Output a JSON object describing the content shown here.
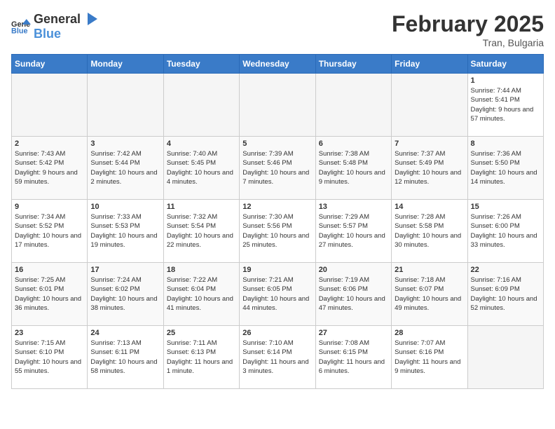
{
  "header": {
    "logo_general": "General",
    "logo_blue": "Blue",
    "title": "February 2025",
    "subtitle": "Tran, Bulgaria"
  },
  "columns": [
    "Sunday",
    "Monday",
    "Tuesday",
    "Wednesday",
    "Thursday",
    "Friday",
    "Saturday"
  ],
  "weeks": [
    {
      "days": [
        {
          "number": "",
          "info": "",
          "empty": true
        },
        {
          "number": "",
          "info": "",
          "empty": true
        },
        {
          "number": "",
          "info": "",
          "empty": true
        },
        {
          "number": "",
          "info": "",
          "empty": true
        },
        {
          "number": "",
          "info": "",
          "empty": true
        },
        {
          "number": "",
          "info": "",
          "empty": true
        },
        {
          "number": "1",
          "info": "Sunrise: 7:44 AM\nSunset: 5:41 PM\nDaylight: 9 hours and 57 minutes.",
          "empty": false
        }
      ]
    },
    {
      "days": [
        {
          "number": "2",
          "info": "Sunrise: 7:43 AM\nSunset: 5:42 PM\nDaylight: 9 hours and 59 minutes.",
          "empty": false
        },
        {
          "number": "3",
          "info": "Sunrise: 7:42 AM\nSunset: 5:44 PM\nDaylight: 10 hours and 2 minutes.",
          "empty": false
        },
        {
          "number": "4",
          "info": "Sunrise: 7:40 AM\nSunset: 5:45 PM\nDaylight: 10 hours and 4 minutes.",
          "empty": false
        },
        {
          "number": "5",
          "info": "Sunrise: 7:39 AM\nSunset: 5:46 PM\nDaylight: 10 hours and 7 minutes.",
          "empty": false
        },
        {
          "number": "6",
          "info": "Sunrise: 7:38 AM\nSunset: 5:48 PM\nDaylight: 10 hours and 9 minutes.",
          "empty": false
        },
        {
          "number": "7",
          "info": "Sunrise: 7:37 AM\nSunset: 5:49 PM\nDaylight: 10 hours and 12 minutes.",
          "empty": false
        },
        {
          "number": "8",
          "info": "Sunrise: 7:36 AM\nSunset: 5:50 PM\nDaylight: 10 hours and 14 minutes.",
          "empty": false
        }
      ]
    },
    {
      "days": [
        {
          "number": "9",
          "info": "Sunrise: 7:34 AM\nSunset: 5:52 PM\nDaylight: 10 hours and 17 minutes.",
          "empty": false
        },
        {
          "number": "10",
          "info": "Sunrise: 7:33 AM\nSunset: 5:53 PM\nDaylight: 10 hours and 19 minutes.",
          "empty": false
        },
        {
          "number": "11",
          "info": "Sunrise: 7:32 AM\nSunset: 5:54 PM\nDaylight: 10 hours and 22 minutes.",
          "empty": false
        },
        {
          "number": "12",
          "info": "Sunrise: 7:30 AM\nSunset: 5:56 PM\nDaylight: 10 hours and 25 minutes.",
          "empty": false
        },
        {
          "number": "13",
          "info": "Sunrise: 7:29 AM\nSunset: 5:57 PM\nDaylight: 10 hours and 27 minutes.",
          "empty": false
        },
        {
          "number": "14",
          "info": "Sunrise: 7:28 AM\nSunset: 5:58 PM\nDaylight: 10 hours and 30 minutes.",
          "empty": false
        },
        {
          "number": "15",
          "info": "Sunrise: 7:26 AM\nSunset: 6:00 PM\nDaylight: 10 hours and 33 minutes.",
          "empty": false
        }
      ]
    },
    {
      "days": [
        {
          "number": "16",
          "info": "Sunrise: 7:25 AM\nSunset: 6:01 PM\nDaylight: 10 hours and 36 minutes.",
          "empty": false
        },
        {
          "number": "17",
          "info": "Sunrise: 7:24 AM\nSunset: 6:02 PM\nDaylight: 10 hours and 38 minutes.",
          "empty": false
        },
        {
          "number": "18",
          "info": "Sunrise: 7:22 AM\nSunset: 6:04 PM\nDaylight: 10 hours and 41 minutes.",
          "empty": false
        },
        {
          "number": "19",
          "info": "Sunrise: 7:21 AM\nSunset: 6:05 PM\nDaylight: 10 hours and 44 minutes.",
          "empty": false
        },
        {
          "number": "20",
          "info": "Sunrise: 7:19 AM\nSunset: 6:06 PM\nDaylight: 10 hours and 47 minutes.",
          "empty": false
        },
        {
          "number": "21",
          "info": "Sunrise: 7:18 AM\nSunset: 6:07 PM\nDaylight: 10 hours and 49 minutes.",
          "empty": false
        },
        {
          "number": "22",
          "info": "Sunrise: 7:16 AM\nSunset: 6:09 PM\nDaylight: 10 hours and 52 minutes.",
          "empty": false
        }
      ]
    },
    {
      "days": [
        {
          "number": "23",
          "info": "Sunrise: 7:15 AM\nSunset: 6:10 PM\nDaylight: 10 hours and 55 minutes.",
          "empty": false
        },
        {
          "number": "24",
          "info": "Sunrise: 7:13 AM\nSunset: 6:11 PM\nDaylight: 10 hours and 58 minutes.",
          "empty": false
        },
        {
          "number": "25",
          "info": "Sunrise: 7:11 AM\nSunset: 6:13 PM\nDaylight: 11 hours and 1 minute.",
          "empty": false
        },
        {
          "number": "26",
          "info": "Sunrise: 7:10 AM\nSunset: 6:14 PM\nDaylight: 11 hours and 3 minutes.",
          "empty": false
        },
        {
          "number": "27",
          "info": "Sunrise: 7:08 AM\nSunset: 6:15 PM\nDaylight: 11 hours and 6 minutes.",
          "empty": false
        },
        {
          "number": "28",
          "info": "Sunrise: 7:07 AM\nSunset: 6:16 PM\nDaylight: 11 hours and 9 minutes.",
          "empty": false
        },
        {
          "number": "",
          "info": "",
          "empty": true
        }
      ]
    }
  ]
}
